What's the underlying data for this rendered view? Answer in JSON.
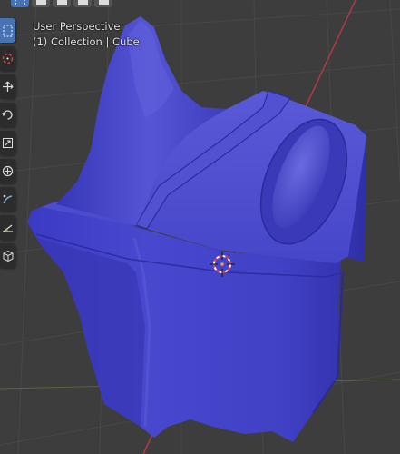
{
  "viewport": {
    "view_name": "User Perspective",
    "collection_info": "(1) Collection | Cube",
    "object_color": "#4646c8",
    "background_color": "#3d3d3d",
    "x_axis_color": "#b03a46",
    "y_axis_color": "#84b43c"
  },
  "header": {
    "selection_modes": [
      {
        "name": "select-box-mode-icon",
        "active": true
      },
      {
        "name": "extend-selection-icon",
        "active": false
      },
      {
        "name": "subtract-selection-icon",
        "active": false
      },
      {
        "name": "invert-selection-icon",
        "active": false
      },
      {
        "name": "intersect-selection-icon",
        "active": false
      }
    ]
  },
  "toolbar": {
    "tools": [
      {
        "name": "select-box-tool",
        "icon": "select-box-icon",
        "active": true
      },
      {
        "name": "cursor-tool",
        "icon": "cursor-icon",
        "active": false
      },
      {
        "name": "move-tool",
        "icon": "move-icon",
        "active": false
      },
      {
        "name": "rotate-tool",
        "icon": "rotate-icon",
        "active": false
      },
      {
        "name": "scale-tool",
        "icon": "scale-icon",
        "active": false
      },
      {
        "name": "transform-tool",
        "icon": "transform-icon",
        "active": false
      },
      {
        "name": "annotate-tool",
        "icon": "annotate-icon",
        "active": false
      },
      {
        "name": "measure-tool",
        "icon": "measure-icon",
        "active": false
      },
      {
        "name": "add-cube-tool",
        "icon": "add-cube-icon",
        "active": false
      }
    ]
  }
}
